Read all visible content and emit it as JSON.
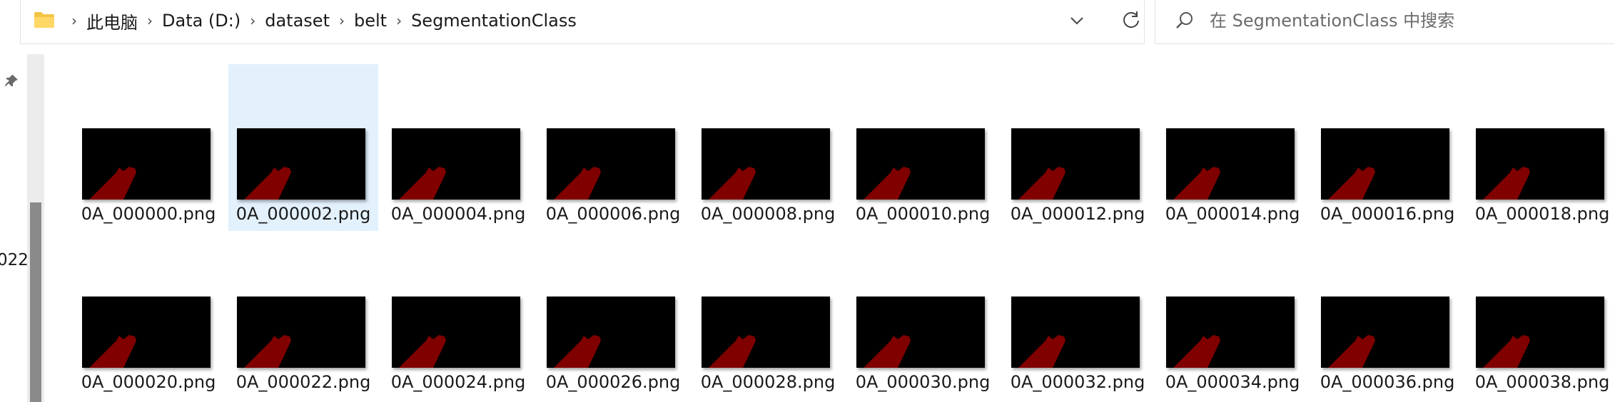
{
  "address_bar": {
    "folder_icon": "folder-icon",
    "separator": "›",
    "breadcrumbs": [
      "此电脑",
      "Data (D:)",
      "dataset",
      "belt",
      "SegmentationClass"
    ],
    "dropdown_icon": "chevron-down-icon",
    "refresh_icon": "refresh-icon"
  },
  "search": {
    "icon": "search-icon",
    "placeholder": "在 SegmentationClass 中搜索"
  },
  "nav_pane": {
    "pin_icon": "pin-icon",
    "partial_text": "022"
  },
  "colors": {
    "selection": "#e3f1fd",
    "mask_red": "#800000",
    "thumb_bg": "#000000"
  },
  "files": [
    {
      "name": "0A_000000.png",
      "selected": false
    },
    {
      "name": "0A_000002.png",
      "selected": true
    },
    {
      "name": "0A_000004.png",
      "selected": false
    },
    {
      "name": "0A_000006.png",
      "selected": false
    },
    {
      "name": "0A_000008.png",
      "selected": false
    },
    {
      "name": "0A_000010.png",
      "selected": false
    },
    {
      "name": "0A_000012.png",
      "selected": false
    },
    {
      "name": "0A_000014.png",
      "selected": false
    },
    {
      "name": "0A_000016.png",
      "selected": false
    },
    {
      "name": "0A_000018.png",
      "selected": false
    },
    {
      "name": "0A_000020.png",
      "selected": false
    },
    {
      "name": "0A_000022.png",
      "selected": false
    },
    {
      "name": "0A_000024.png",
      "selected": false
    },
    {
      "name": "0A_000026.png",
      "selected": false
    },
    {
      "name": "0A_000028.png",
      "selected": false
    },
    {
      "name": "0A_000030.png",
      "selected": false
    },
    {
      "name": "0A_000032.png",
      "selected": false
    },
    {
      "name": "0A_000034.png",
      "selected": false
    },
    {
      "name": "0A_000036.png",
      "selected": false
    },
    {
      "name": "0A_000038.png",
      "selected": false
    }
  ]
}
